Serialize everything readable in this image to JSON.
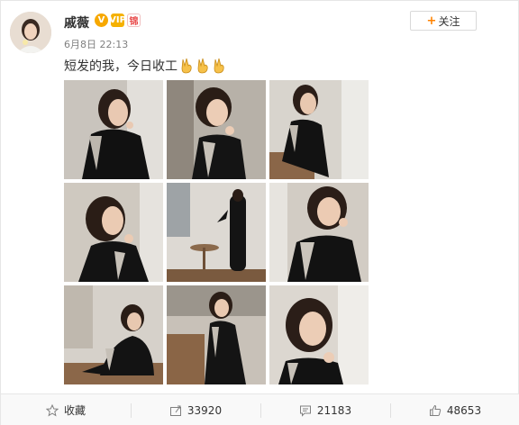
{
  "user": {
    "name": "戚薇",
    "badges": [
      "V",
      "VIP",
      "锦"
    ]
  },
  "post": {
    "date": "6月8日 22:13",
    "text": "短发的我，今日收工",
    "emoji": [
      "victory-hand",
      "victory-hand",
      "victory-hand"
    ]
  },
  "follow_button": {
    "plus": "+",
    "label": "关注"
  },
  "photos": [
    {
      "desc": "portrait-1"
    },
    {
      "desc": "portrait-2"
    },
    {
      "desc": "portrait-3"
    },
    {
      "desc": "portrait-4"
    },
    {
      "desc": "portrait-5"
    },
    {
      "desc": "portrait-6"
    },
    {
      "desc": "portrait-7"
    },
    {
      "desc": "portrait-8"
    },
    {
      "desc": "portrait-9"
    }
  ],
  "actions": {
    "favorite": {
      "label": "收藏",
      "icon": "star-icon"
    },
    "repost": {
      "count": "33920",
      "icon": "repost-icon"
    },
    "comment": {
      "count": "21183",
      "icon": "comment-icon"
    },
    "like": {
      "count": "48653",
      "icon": "thumbs-up-icon"
    }
  },
  "colors": {
    "accent": "#ff8200",
    "text": "#333333",
    "muted": "#808080"
  }
}
